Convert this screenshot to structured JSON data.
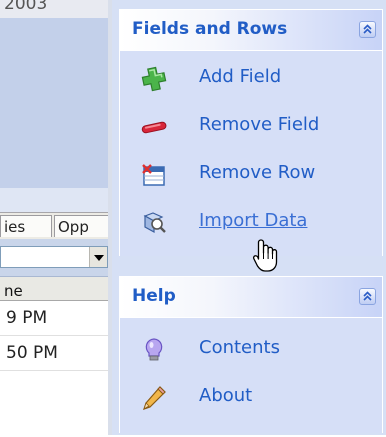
{
  "background": {
    "top_text": "2003",
    "tabs": [
      "ies",
      "Opp"
    ],
    "grid_header": "ne",
    "grid_rows": [
      "9 PM",
      "50 PM"
    ]
  },
  "task_pane": {
    "fields_rows": {
      "title": "Fields and Rows",
      "items": [
        {
          "label": "Add Field",
          "icon": "green-plus-icon"
        },
        {
          "label": "Remove Field",
          "icon": "red-minus-icon"
        },
        {
          "label": "Remove Row",
          "icon": "remove-row-icon"
        },
        {
          "label": "Import Data",
          "icon": "import-data-icon"
        }
      ]
    },
    "help": {
      "title": "Help",
      "items": [
        {
          "label": "Contents",
          "icon": "lightbulb-icon"
        },
        {
          "label": "About",
          "icon": "pencil-icon"
        }
      ]
    }
  },
  "colors": {
    "link": "#215dc6",
    "pane_bg": "#d6e0f5",
    "header_gradient_end": "#c7d3f7"
  }
}
